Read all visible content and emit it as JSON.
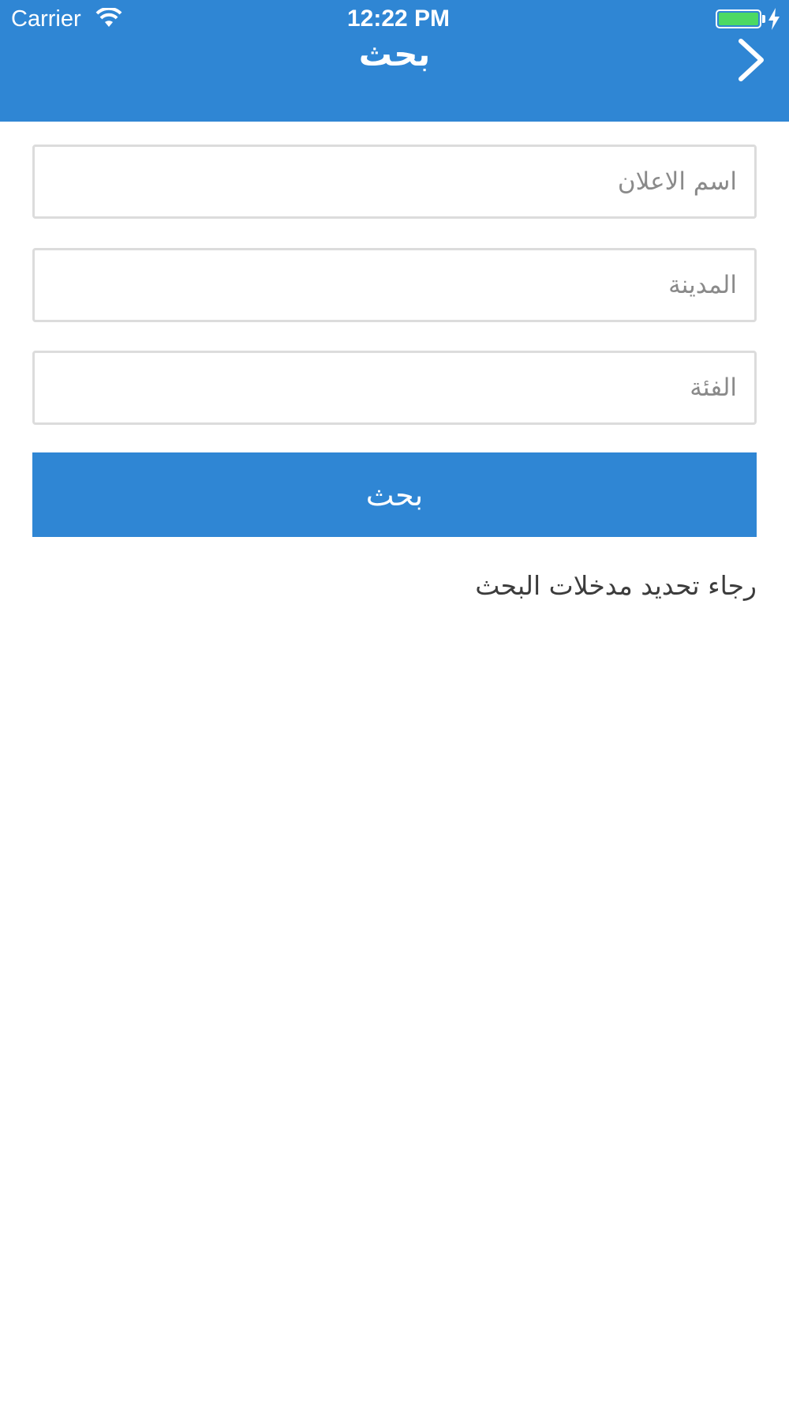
{
  "status_bar": {
    "carrier": "Carrier",
    "time": "12:22 PM",
    "battery_color": "#4cd964"
  },
  "nav": {
    "title": "بحث",
    "back_icon": "chevron-right-icon",
    "background_color": "#2f86d4"
  },
  "form": {
    "ad_name": {
      "placeholder": "اسم الاعلان",
      "value": ""
    },
    "city": {
      "placeholder": "المدينة",
      "value": ""
    },
    "category": {
      "placeholder": "الفئة",
      "value": ""
    },
    "search_label": "بحث"
  },
  "message": "رجاء تحديد مدخلات البحث"
}
